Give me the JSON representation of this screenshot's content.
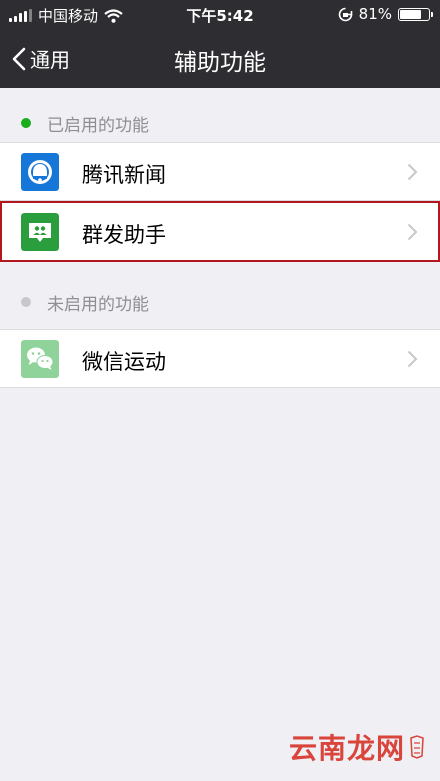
{
  "status_bar": {
    "carrier": "中国移动",
    "time": "下午5:42",
    "battery": "81%",
    "battery_level": 0.81
  },
  "nav": {
    "back_label": "通用",
    "title": "辅助功能"
  },
  "sections": [
    {
      "header": "已启用的功能",
      "dot_color": "#1aad19",
      "items": [
        {
          "label": "腾讯新闻",
          "icon": "tencent-news-icon"
        },
        {
          "label": "群发助手",
          "icon": "mass-message-icon",
          "selected": true
        }
      ]
    },
    {
      "header": "未启用的功能",
      "dot_color": "#c7c7cc",
      "items": [
        {
          "label": "微信运动",
          "icon": "wechat-sports-icon"
        }
      ]
    }
  ],
  "watermark": {
    "text": "云南龙网",
    "icon": "watermark-logo"
  }
}
